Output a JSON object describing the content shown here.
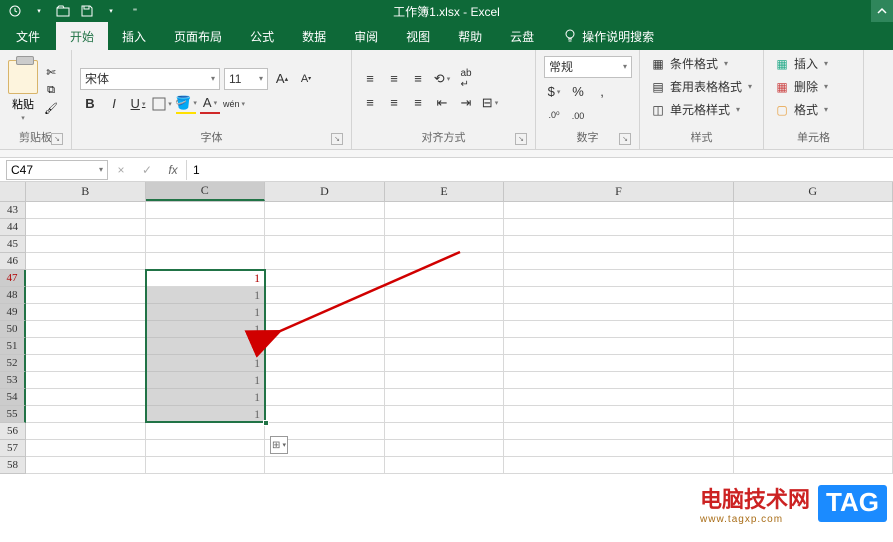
{
  "title": "工作簿1.xlsx - Excel",
  "tabs": {
    "file": "文件",
    "home": "开始",
    "insert": "插入",
    "layout": "页面布局",
    "formulas": "公式",
    "data": "数据",
    "review": "审阅",
    "view": "视图",
    "help": "帮助",
    "cloud": "云盘",
    "tellme": "操作说明搜索"
  },
  "ribbon": {
    "clipboard": {
      "label": "剪贴板",
      "paste": "粘贴"
    },
    "font": {
      "label": "字体",
      "name": "宋体",
      "size": "11",
      "ruby": "wén"
    },
    "alignment": {
      "label": "对齐方式"
    },
    "number": {
      "label": "数字",
      "format": "常规"
    },
    "styles": {
      "label": "样式",
      "cond": "条件格式",
      "table": "套用表格格式",
      "cell": "单元格样式"
    },
    "cells": {
      "label": "单元格",
      "insert": "插入",
      "delete": "删除",
      "format": "格式"
    }
  },
  "namebox": "C47",
  "fx": "fx",
  "formula_value": "1",
  "cols": [
    "B",
    "C",
    "D",
    "E",
    "F",
    "G"
  ],
  "rows": [
    "43",
    "44",
    "45",
    "46",
    "47",
    "48",
    "49",
    "50",
    "51",
    "52",
    "53",
    "54",
    "55",
    "56",
    "57",
    "58"
  ],
  "chart_data": {
    "type": "table",
    "active_cell": "C47",
    "selected_range": "C47:C55",
    "values": {
      "C47": "1",
      "C48": "1",
      "C49": "1",
      "C50": "1",
      "C51": "1",
      "C52": "1",
      "C53": "1",
      "C54": "1",
      "C55": "1"
    }
  },
  "watermark": {
    "t1": "电脑技术网",
    "t1sub": "www.tagxp.com",
    "t2": "TAG"
  }
}
